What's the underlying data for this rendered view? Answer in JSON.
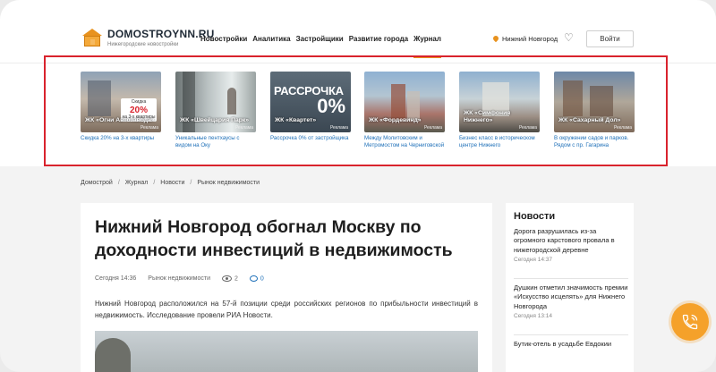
{
  "header": {
    "logo_title": "DOMOSTROYNN.RU",
    "logo_subtitle": "Нижегородские новостройки",
    "nav": [
      "Новостройки",
      "Аналитика",
      "Застройщики",
      "Развитие города",
      "Журнал"
    ],
    "active_nav": "Журнал",
    "city": "Нижний Новгород",
    "login_label": "Войти"
  },
  "carousel": [
    {
      "title": "ЖК «Огни Автозавода»",
      "caption": "Скидка 20% на 3-х квартиры",
      "ad": "Реклама",
      "promo_top": "Скидка",
      "promo_value": "20%",
      "promo_bottom": "на 3-х квартиры"
    },
    {
      "title": "ЖК «Швейцария Парк»",
      "caption": "Уникальные пентхаусы с видом на Оку",
      "ad": "Реклама"
    },
    {
      "title": "ЖК «Квартет»",
      "caption": "Рассрочка 0% от застройщика",
      "ad": "Реклама",
      "big_text": "РАССРОЧКА",
      "big_value": "0%"
    },
    {
      "title": "ЖК «Фордевинд»",
      "caption": "Между Молитовским и Метромостом на Черниговской",
      "ad": "Реклама"
    },
    {
      "title": "ЖК «Симфония Нижнего»",
      "caption": "Бизнес класс в историческом центре Нижнего",
      "ad": "Реклама"
    },
    {
      "title": "ЖК «Сахарный Дол»",
      "caption": "В окружении садов и парков. Рядом с пр. Гагарина",
      "ad": "Реклама"
    }
  ],
  "breadcrumb": [
    "Домострой",
    "Журнал",
    "Новости",
    "Рынок недвижимости"
  ],
  "article": {
    "title": "Нижний Новгород обогнал Москву по доходности инвестиций в недвижимость",
    "date": "Сегодня 14:36",
    "category": "Рынок недвижимости",
    "views": "2",
    "comments": "0",
    "lead": "Нижний Новгород расположился на 57-й позиции среди российских регионов по прибыльности инвестиций в недвижимость. Исследование провели РИА Новости."
  },
  "news": {
    "heading": "Новости",
    "items": [
      {
        "text": "Дорога разрушилась из-за огромного карстового провала в нижегородской деревне",
        "time": "Сегодня 14:37"
      },
      {
        "text": "Душкин отметил значимость премии «Искусство исцелять» для Нижнего Новгорода",
        "time": "Сегодня 13:14"
      },
      {
        "text": "Бутик-отель в усадьбе Евдокии",
        "time": ""
      }
    ]
  },
  "colors": {
    "accent": "#f5a12a",
    "link": "#1d6fb8",
    "highlight": "#d9232d"
  },
  "icons": {
    "logo": "house-logo-icon",
    "city": "location-pin-icon",
    "favorites": "heart-icon",
    "views": "eye-icon",
    "comments": "comment-icon",
    "call": "phone-icon"
  }
}
